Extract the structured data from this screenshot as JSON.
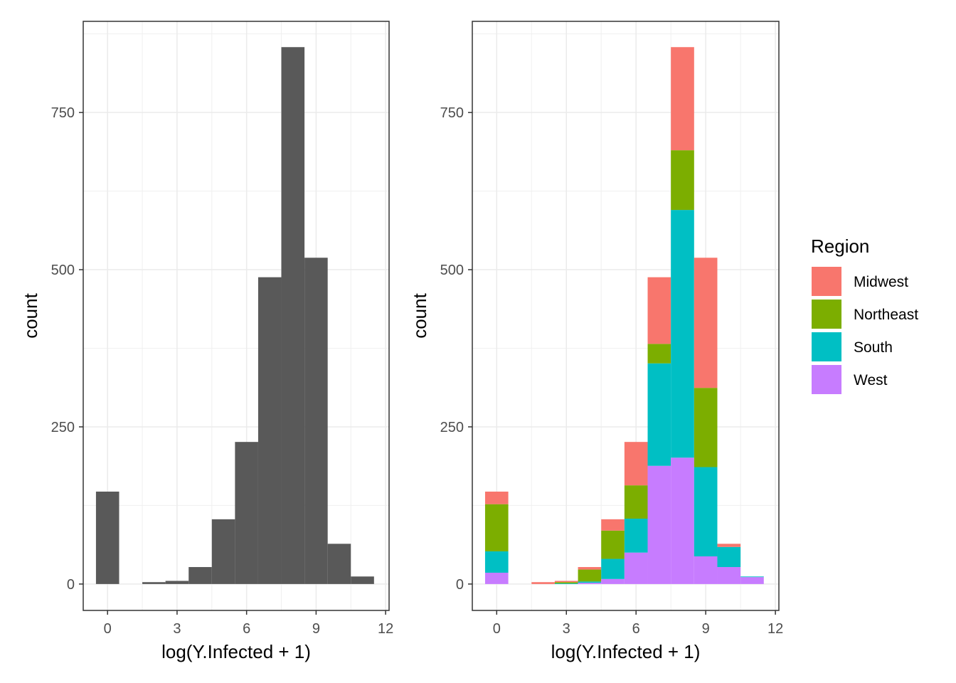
{
  "chart_data": [
    {
      "type": "bar",
      "subtype": "histogram",
      "xlabel": "log(Y.Infected + 1)",
      "ylabel": "count",
      "xlim": [
        -1.05,
        12.15
      ],
      "ylim": [
        -42,
        895
      ],
      "xticks": [
        0,
        3,
        6,
        9,
        12
      ],
      "yticks": [
        0,
        250,
        500,
        750
      ],
      "grid": true,
      "bin_width": 1,
      "bin_centers": [
        0,
        1,
        2,
        3,
        4,
        5,
        6,
        7,
        8,
        9,
        10,
        11
      ],
      "values": [
        147,
        0,
        3,
        5,
        27,
        103,
        226,
        488,
        854,
        519,
        64,
        12
      ],
      "color": "#595959"
    },
    {
      "type": "bar",
      "subtype": "stacked histogram",
      "xlabel": "log(Y.Infected + 1)",
      "ylabel": "count",
      "xlim": [
        -1.05,
        12.15
      ],
      "ylim": [
        -42,
        895
      ],
      "xticks": [
        0,
        3,
        6,
        9,
        12
      ],
      "yticks": [
        0,
        250,
        500,
        750
      ],
      "grid": true,
      "bin_width": 1,
      "bin_centers": [
        0,
        1,
        2,
        3,
        4,
        5,
        6,
        7,
        8,
        9,
        10,
        11
      ],
      "legend": {
        "title": "Region",
        "placement": "right"
      },
      "series": [
        {
          "name": "Midwest",
          "color": "#F8766D",
          "values": [
            20,
            0,
            3,
            2,
            4,
            18,
            69,
            106,
            164,
            207,
            5,
            0
          ]
        },
        {
          "name": "Northeast",
          "color": "#7CAE00",
          "values": [
            75,
            0,
            0,
            2,
            19,
            45,
            53,
            31,
            95,
            126,
            0,
            0
          ]
        },
        {
          "name": "South",
          "color": "#00BFC4",
          "values": [
            34,
            0,
            0,
            1,
            2,
            32,
            54,
            163,
            394,
            142,
            32,
            1
          ]
        },
        {
          "name": "West",
          "color": "#C77CFF",
          "values": [
            18,
            0,
            0,
            0,
            2,
            8,
            50,
            188,
            201,
            44,
            27,
            11
          ]
        }
      ]
    }
  ]
}
